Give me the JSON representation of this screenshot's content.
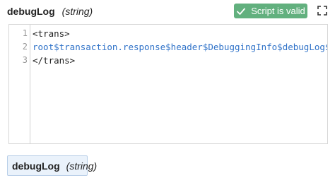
{
  "header": {
    "field_name": "debugLog",
    "field_type": "(string)"
  },
  "status": {
    "label": "Script is valid",
    "color": "#62b07e",
    "icon": "check-icon"
  },
  "expand": {
    "icon": "expand-icon"
  },
  "editor": {
    "line_numbers": [
      "1",
      "2",
      "3"
    ],
    "lines": [
      "<trans>",
      "root$transaction.response$header$DebuggingInfo$debugLog$",
      "</trans>"
    ],
    "variable_color": "#2f72c8"
  },
  "footer_tag": {
    "field_name": "debugLog",
    "field_type": "(string)"
  }
}
